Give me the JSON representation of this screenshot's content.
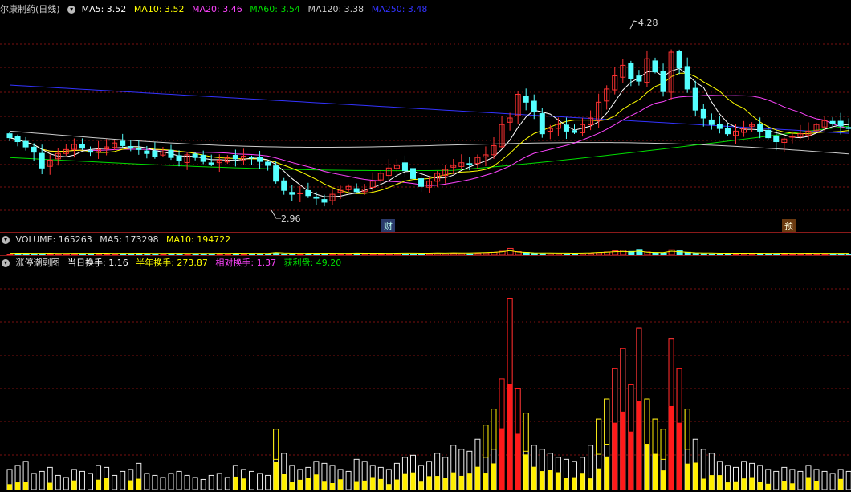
{
  "main": {
    "stock_name": "尔康制药(日线)",
    "ma": [
      {
        "label": "MA5: 3.52",
        "color": "#ffffff"
      },
      {
        "label": "MA10: 3.52",
        "color": "#ffff00"
      },
      {
        "label": "MA20: 3.46",
        "color": "#ff44ff"
      },
      {
        "label": "MA60: 3.54",
        "color": "#00dd00"
      },
      {
        "label": "MA120: 3.38",
        "color": "#cccccc"
      },
      {
        "label": "MA250: 3.48",
        "color": "#3333ff"
      }
    ],
    "high_label": "4.28",
    "low_label": "2.96",
    "marker_cai": "财",
    "marker_yu": "预"
  },
  "volume": {
    "title": "VOLUME: 165263",
    "ma5": "MA5: 173298",
    "ma10": "MA10: 194722"
  },
  "sub": {
    "title": "涨停潮副图",
    "t1": "当日换手: 1.16",
    "t2": "半年换手: 273.87",
    "t3": "相对换手: 1.37",
    "t4": "获利盘: 49.20"
  },
  "colors": {
    "up": "#ff3232",
    "down": "#54ffff",
    "grid": "#7a1010",
    "ma5": "#ffffff",
    "ma10": "#ffff00",
    "ma20": "#ff44ff",
    "ma60": "#00dd00",
    "ma120": "#cccccc",
    "ma250": "#3333ff"
  },
  "chart_data": {
    "type": "candlestick",
    "ylim": [
      2.85,
      4.35
    ],
    "price_ticks": [
      2.96,
      4.28
    ],
    "close": [
      3.45,
      3.42,
      3.38,
      3.34,
      3.22,
      3.28,
      3.33,
      3.36,
      3.4,
      3.37,
      3.34,
      3.36,
      3.38,
      3.41,
      3.39,
      3.37,
      3.36,
      3.33,
      3.31,
      3.34,
      3.3,
      3.28,
      3.32,
      3.3,
      3.27,
      3.25,
      3.28,
      3.3,
      3.29,
      3.31,
      3.3,
      3.27,
      3.24,
      3.12,
      3.05,
      3.02,
      3.03,
      3.01,
      2.99,
      2.96,
      3.02,
      3.05,
      3.08,
      3.04,
      3.06,
      3.12,
      3.18,
      3.22,
      3.24,
      3.2,
      3.14,
      3.08,
      3.12,
      3.18,
      3.21,
      3.24,
      3.26,
      3.25,
      3.3,
      3.32,
      3.39,
      3.55,
      3.6,
      3.78,
      3.72,
      3.65,
      3.48,
      3.52,
      3.55,
      3.5,
      3.49,
      3.55,
      3.6,
      3.72,
      3.82,
      3.92,
      4.0,
      3.9,
      3.88,
      4.05,
      3.95,
      3.8,
      4.1,
      3.98,
      3.82,
      3.66,
      3.6,
      3.55,
      3.52,
      3.48,
      3.5,
      3.52,
      3.55,
      3.5,
      3.45,
      3.42,
      3.44,
      3.46,
      3.48,
      3.5,
      3.55,
      3.58,
      3.56,
      3.54,
      3.52
    ]
  },
  "turnover_bars": [
    0.1,
    0.12,
    0.14,
    0.08,
    0.09,
    0.11,
    0.07,
    0.06,
    0.1,
    0.09,
    0.08,
    0.12,
    0.11,
    0.07,
    0.09,
    0.1,
    0.13,
    0.08,
    0.07,
    0.06,
    0.08,
    0.09,
    0.07,
    0.06,
    0.05,
    0.07,
    0.08,
    0.06,
    0.12,
    0.1,
    0.09,
    0.08,
    0.07,
    0.3,
    0.18,
    0.12,
    0.1,
    0.11,
    0.14,
    0.13,
    0.12,
    0.1,
    0.09,
    0.15,
    0.14,
    0.12,
    0.11,
    0.1,
    0.13,
    0.16,
    0.17,
    0.12,
    0.14,
    0.18,
    0.16,
    0.22,
    0.2,
    0.19,
    0.25,
    0.32,
    0.4,
    0.55,
    0.95,
    0.5,
    0.38,
    0.22,
    0.2,
    0.18,
    0.16,
    0.15,
    0.14,
    0.16,
    0.22,
    0.35,
    0.45,
    0.6,
    0.7,
    0.52,
    0.8,
    0.45,
    0.35,
    0.3,
    0.75,
    0.6,
    0.4,
    0.25,
    0.2,
    0.18,
    0.14,
    0.12,
    0.11,
    0.14,
    0.13,
    0.12,
    0.1,
    0.09,
    0.11,
    0.1,
    0.09,
    0.12,
    0.1,
    0.09,
    0.08,
    0.1,
    0.09
  ]
}
